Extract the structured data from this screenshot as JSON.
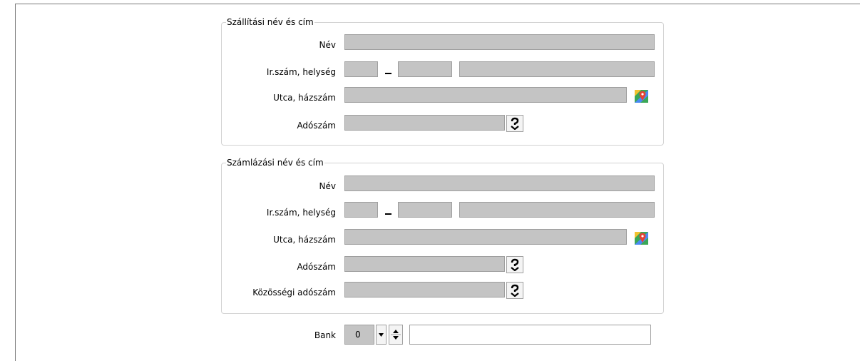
{
  "shipping": {
    "title": "Szállítási név és cím",
    "name_label": "Név",
    "zip_city_label": "Ir.szám, helység",
    "street_label": "Utca, házszám",
    "tax_label": "Adószám",
    "zip_separator": "–"
  },
  "billing": {
    "title": "Számlázási név és cím",
    "name_label": "Név",
    "zip_city_label": "Ir.szám, helység",
    "street_label": "Utca, házszám",
    "tax_label": "Adószám",
    "eu_tax_label": "Közösségi adószám",
    "zip_separator": "–"
  },
  "bank": {
    "label": "Bank",
    "selected_value": "0",
    "text_value": ""
  },
  "icons": {
    "map": "map-pin-icon",
    "tax_lookup": "tax-lookup-icon",
    "dropdown": "chevron-down-icon",
    "spin": "spin-up-down-icon"
  },
  "colors": {
    "field_background": "#c4c4c4",
    "group_border": "#d2d2d2"
  }
}
